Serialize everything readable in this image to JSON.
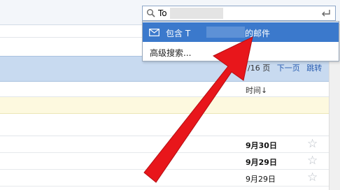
{
  "search": {
    "query": "To"
  },
  "dropdown": {
    "contains_prefix": "包含 T",
    "contains_suffix": "的邮件",
    "advanced_search": "高级搜索..."
  },
  "toolbar": {
    "page_info": "/16 页",
    "next_page": "下一页",
    "jump": "跳转"
  },
  "list": {
    "time_header": "时间↓",
    "rows": [
      {
        "date": "9月30日",
        "bold": true
      },
      {
        "date": "9月29日",
        "bold": true
      },
      {
        "date": "9月29日",
        "bold": false
      }
    ],
    "star_glyph": "☆"
  },
  "colors": {
    "highlight": "#3b79cc",
    "header_bg": "#c8daf0",
    "notice_bg": "#fdf9df",
    "arrow": "#e8161b"
  },
  "icons": [
    "search-icon",
    "enter-icon",
    "envelope-icon",
    "star-icon",
    "arrow-annotation"
  ]
}
